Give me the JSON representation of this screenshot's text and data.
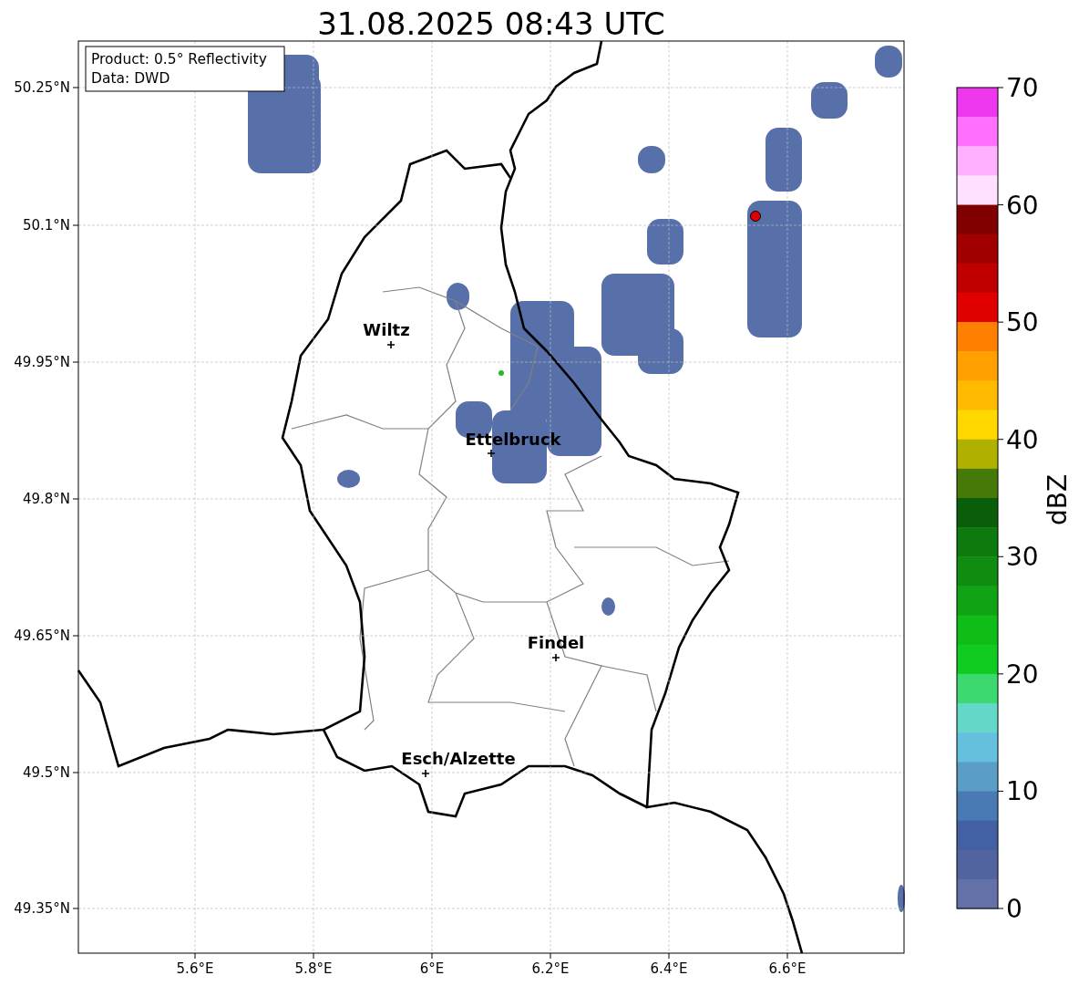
{
  "title": "31.08.2025 08:43 UTC",
  "info_box": {
    "lines": [
      "Product: 0.5° Reflectivity",
      "Data: DWD"
    ]
  },
  "y_ticks": [
    "50.25°N",
    "50.1°N",
    "49.95°N",
    "49.8°N",
    "49.65°N",
    "49.5°N",
    "49.35°N"
  ],
  "x_ticks": [
    "5.6°E",
    "5.8°E",
    "6°E",
    "6.2°E",
    "6.4°E",
    "6.6°E"
  ],
  "cities": [
    {
      "name": "Wiltz"
    },
    {
      "name": "Ettelbruck"
    },
    {
      "name": "Findel"
    },
    {
      "name": "Esch/Alzette"
    }
  ],
  "colorbar": {
    "label": "dBZ",
    "ticks": [
      "70",
      "60",
      "50",
      "40",
      "30",
      "20",
      "10",
      "0"
    ],
    "bins": [
      {
        "color": "#ee38ee"
      },
      {
        "color": "#ff70ff"
      },
      {
        "color": "#ffb0ff"
      },
      {
        "color": "#ffe0ff"
      },
      {
        "color": "#800000"
      },
      {
        "color": "#a00000"
      },
      {
        "color": "#c00000"
      },
      {
        "color": "#e00000"
      },
      {
        "color": "#ff8000"
      },
      {
        "color": "#ffa000"
      },
      {
        "color": "#ffba00"
      },
      {
        "color": "#ffd800"
      },
      {
        "color": "#b0b000"
      },
      {
        "color": "#467a08"
      },
      {
        "color": "#0a5e0a"
      },
      {
        "color": "#0c7a0c"
      },
      {
        "color": "#108c10"
      },
      {
        "color": "#10a414"
      },
      {
        "color": "#10bc18"
      },
      {
        "color": "#10cc20"
      },
      {
        "color": "#3cd870"
      },
      {
        "color": "#64d8c8"
      },
      {
        "color": "#64c0dc"
      },
      {
        "color": "#5a9ec8"
      },
      {
        "color": "#4a7ab4"
      },
      {
        "color": "#4460a4"
      },
      {
        "color": "#5264a0"
      },
      {
        "color": "#6470a8"
      }
    ]
  }
}
